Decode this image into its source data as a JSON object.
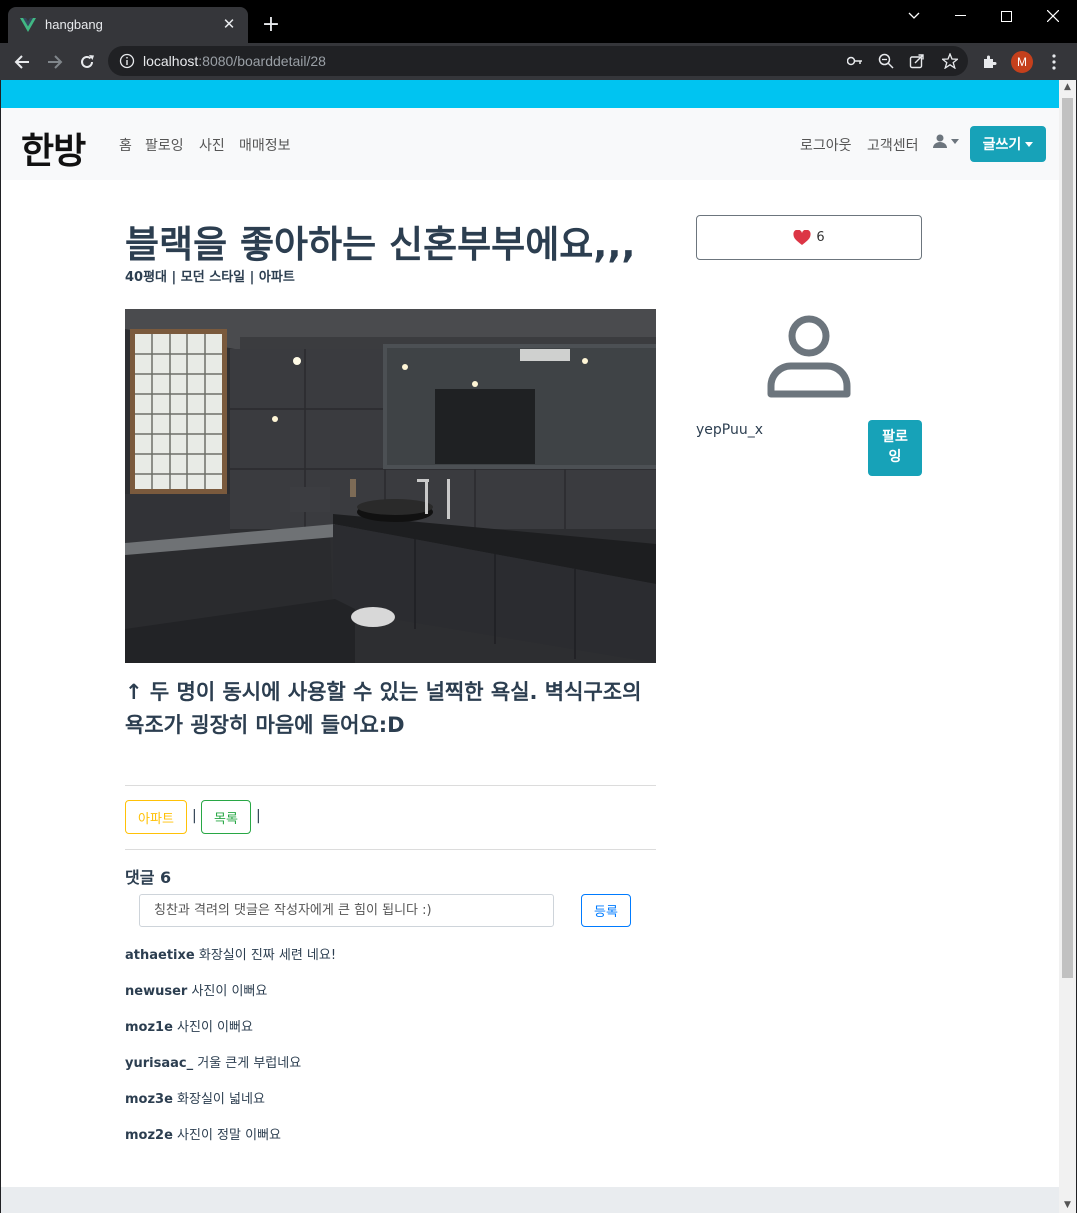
{
  "browser": {
    "tab_title": "hangbang",
    "url_host": "localhost",
    "url_path": ":8080/boarddetail/28",
    "profile_initial": "M"
  },
  "navbar": {
    "brand": "한방",
    "links": [
      "홈",
      "팔로잉",
      "사진",
      "매매정보"
    ],
    "logout": "로그아웃",
    "support": "고객센터",
    "write_button": "글쓰기"
  },
  "post": {
    "title": "블랙을 좋아하는 신혼부부에요,,,",
    "meta": "40평대 | 모던 스타일 | 아파트",
    "caption": "↑ 두 명이 동시에 사용할 수 있는 널찍한 욕실. 벽식구조의 욕조가 굉장히 마음에 들어요:D",
    "tag_button": "아파트",
    "list_button": "목록",
    "separator": "|"
  },
  "comments": {
    "heading": "댓글 6",
    "placeholder": "칭찬과 격려의 댓글은 작성자에게 큰 힘이 됩니다 :)",
    "submit": "등록",
    "items": [
      {
        "author": "athaetixe",
        "text": "화장실이 진짜 세련   네요!"
      },
      {
        "author": "newuser",
        "text": "사진이 이뻐요"
      },
      {
        "author": "moz1e",
        "text": "사진이 이뻐요"
      },
      {
        "author": "yurisaac_",
        "text": "거울 큰게 부럽네요"
      },
      {
        "author": "moz3e",
        "text": "화장실이 넓네요"
      },
      {
        "author": "moz2e",
        "text": "사진이 정말 이뻐요"
      }
    ]
  },
  "sidebar": {
    "like_count": "6",
    "username": "yepPuu_x",
    "follow_button": "팔로잉"
  },
  "colors": {
    "topbar": "#00c4f1",
    "primary": "#17a2b8",
    "heart": "#dc3545",
    "tag": "#ffc107",
    "list": "#28a745",
    "submit": "#007bff"
  }
}
